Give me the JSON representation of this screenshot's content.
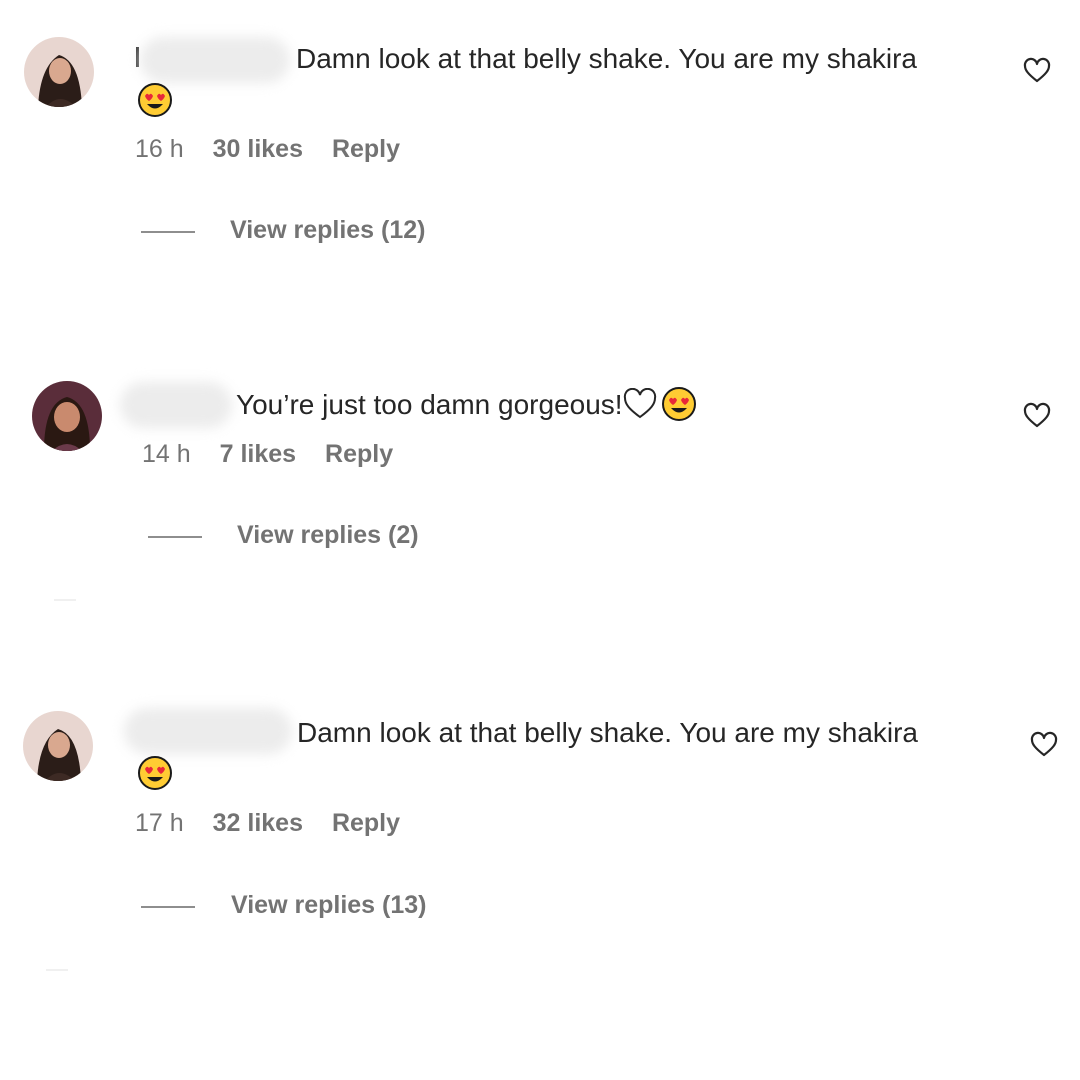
{
  "comments": [
    {
      "text": "Damn look at that belly shake. You are my shakira",
      "time": "16 h",
      "likes": "30 likes",
      "reply": "Reply",
      "view_replies": "View replies (12)",
      "emoji": "heart-eyes-emoji"
    },
    {
      "text": "You’re just too damn gorgeous!",
      "time": "14 h",
      "likes": "7 likes",
      "reply": "Reply",
      "view_replies": "View replies (2)",
      "emoji": "heart-eyes-emoji"
    },
    {
      "text": "Damn look at that belly shake. You are my shakira",
      "time": "17 h",
      "likes": "32 likes",
      "reply": "Reply",
      "view_replies": "View replies (13)",
      "emoji": "heart-eyes-emoji"
    }
  ],
  "colors": {
    "text": "#262626",
    "meta": "#737373",
    "emoji_face": "#FFCC33",
    "emoji_heart": "#E8283A"
  }
}
